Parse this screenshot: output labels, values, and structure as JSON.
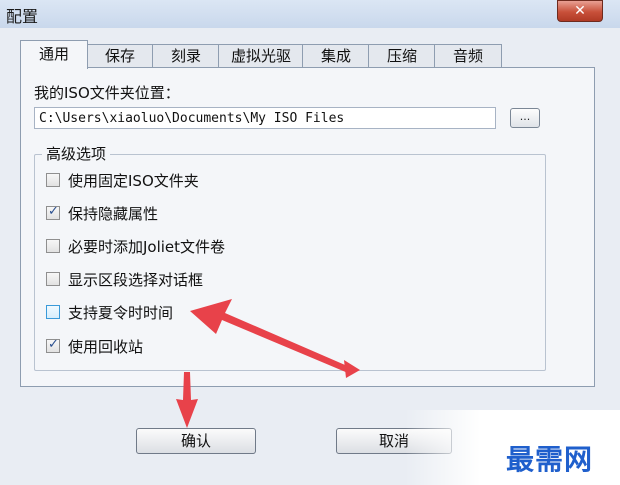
{
  "window": {
    "title": "配置",
    "close_label": "✕"
  },
  "tabs": [
    {
      "label": "通用",
      "active": true
    },
    {
      "label": "保存",
      "active": false
    },
    {
      "label": "刻录",
      "active": false
    },
    {
      "label": "虚拟光驱",
      "active": false
    },
    {
      "label": "集成",
      "active": false
    },
    {
      "label": "压缩",
      "active": false
    },
    {
      "label": "音频",
      "active": false
    }
  ],
  "iso_folder": {
    "label": "我的ISO文件夹位置：",
    "path": "C:\\Users\\xiaoluo\\Documents\\My ISO Files",
    "browse_label": "..."
  },
  "advanced": {
    "title": "高级选项",
    "options": [
      {
        "label": "使用固定ISO文件夹",
        "checked": false
      },
      {
        "label": "保持隐藏属性",
        "checked": true
      },
      {
        "label": "必要时添加Joliet文件卷",
        "checked": false
      },
      {
        "label": "显示区段选择对话框",
        "checked": false
      },
      {
        "label": "支持夏令时时间",
        "checked": false
      },
      {
        "label": "使用回收站",
        "checked": true
      }
    ]
  },
  "buttons": {
    "ok": "确认",
    "cancel": "取消"
  },
  "watermark": "最需网",
  "colors": {
    "annotation_arrow": "#e8424a",
    "watermark": "#1f5fcc"
  }
}
